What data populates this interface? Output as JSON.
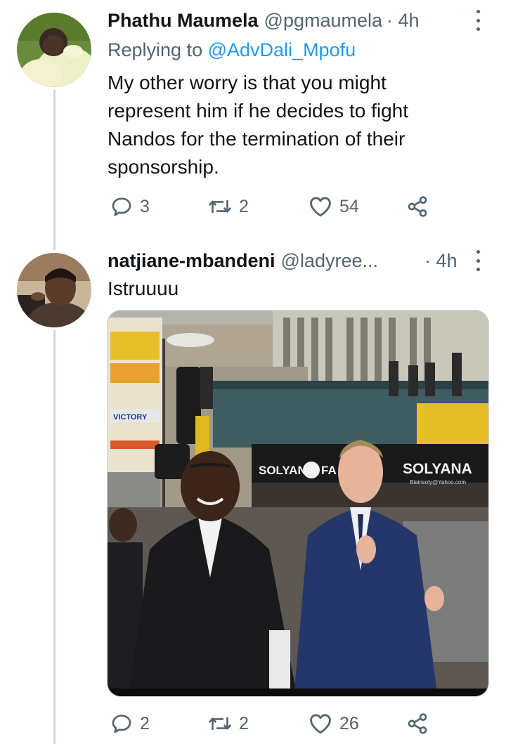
{
  "tweets": [
    {
      "display_name": "Phathu Maumela",
      "handle": "@pgmaumela",
      "time": "· 4h",
      "replying_prefix": "Replying to",
      "replying_to": "@AdvDali_Mpofu",
      "lines": [
        "My other worry is that you might",
        "represent him if he decides to fight",
        "Nandos for the termination of their",
        "sponsorship."
      ],
      "replies": "3",
      "retweets": "2",
      "likes": "54"
    },
    {
      "display_name": "natjiane-mbandeni",
      "handle": "@ladyree...",
      "time": "· 4h",
      "text": "Istruuuu",
      "media": {
        "signs": {
          "solyana_left": "SOLYANA",
          "solyana_right": "SOLYANA",
          "fa": "FA",
          "victory": "VICTORY",
          "email": "Blainsoly@Yahoo.com"
        }
      },
      "replies": "2",
      "retweets": "2",
      "likes": "26"
    }
  ],
  "icons": {
    "reply": "reply-icon",
    "retweet": "retweet-icon",
    "like": "heart-icon",
    "share": "share-icon",
    "more": "more-options-icon"
  },
  "colors": {
    "text": "#0f1419",
    "secondary": "#536471",
    "mention": "#1d9bf0",
    "thread_line": "#cfd9de"
  }
}
